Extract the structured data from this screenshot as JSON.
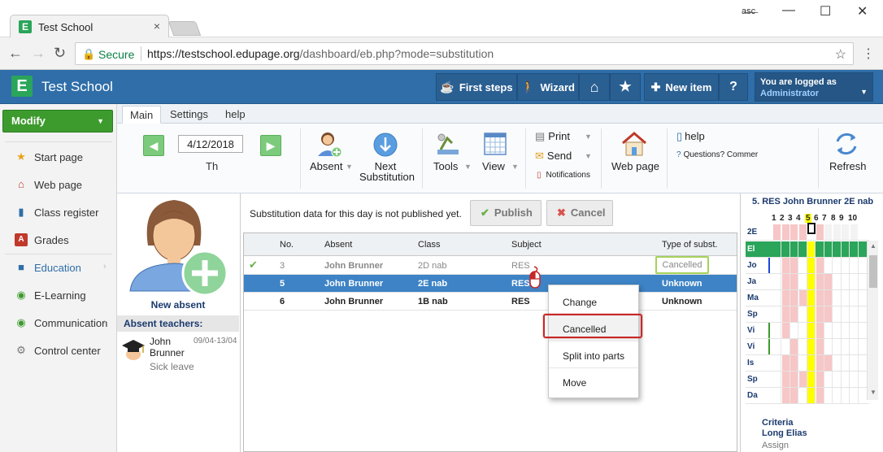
{
  "browser": {
    "tab_title": "Test School",
    "tab_close": "×",
    "favicon_letter": "E",
    "secure_label": "Secure",
    "url_host": "https://testschool.edupage.org",
    "url_path": "/dashboard/eb.php?mode=substitution",
    "user_icon": "a̶s̶c̶",
    "window_controls": [
      "—",
      "☐",
      "✕"
    ]
  },
  "header": {
    "logo_letter": "E",
    "app_name": "Test School",
    "buttons": [
      {
        "icon": "☕",
        "label": "First steps"
      },
      {
        "icon": "🚶",
        "label": "Wizard"
      },
      {
        "icon": "⌂",
        "label": ""
      },
      {
        "icon": "★",
        "label": ""
      },
      {
        "icon": "✚",
        "label": "New item"
      },
      {
        "icon": "?",
        "label": ""
      }
    ],
    "login_line1": "You are logged as",
    "login_line2": "Administrator"
  },
  "sidebar": {
    "modify_label": "Modify",
    "items": [
      {
        "label": "Start page",
        "icon": "★",
        "color": "#e8a317",
        "chevron": ""
      },
      {
        "label": "Web page",
        "icon": "⌂",
        "color": "#c0392b",
        "chevron": ""
      },
      {
        "label": "Class register",
        "icon": "▮",
        "color": "#2f6ea8",
        "chevron": ""
      },
      {
        "label": "Grades",
        "icon": "A",
        "color": "#c0392b",
        "chevron": ""
      },
      {
        "label": "Education",
        "icon": "■",
        "color": "#2f6ea8",
        "chevron": "›"
      },
      {
        "label": "E-Learning",
        "icon": "◉",
        "color": "#3d9b2e",
        "chevron": ""
      },
      {
        "label": "Communication",
        "icon": "◉",
        "color": "#3d9b2e",
        "chevron": "›"
      },
      {
        "label": "Control center",
        "icon": "⚙",
        "color": "#777777",
        "chevron": ""
      }
    ]
  },
  "ribbon": {
    "tabs": [
      "Main",
      "Settings",
      "help"
    ],
    "date": "4/12/2018",
    "day": "Th",
    "absent_label": "Absent",
    "next_line1": "Next",
    "next_line2": "Substitution",
    "tools_label": "Tools",
    "view_label": "View",
    "print_label": "Print",
    "send_label": "Send",
    "notifications_label": "Notifications",
    "webpage_label": "Web page",
    "help_label": "help",
    "questions_label": "Questions? Commer",
    "refresh_label": "Refresh"
  },
  "left_panel": {
    "new_absent_label": "New absent",
    "absent_teachers_header": "Absent teachers:",
    "teacher_first": "John",
    "teacher_last": "Brunner",
    "teacher_dates": "09/04-13/04",
    "teacher_reason": "Sick leave"
  },
  "main": {
    "notice": "Substitution data for this day is not published yet.",
    "publish_label": "Publish",
    "cancel_label": "Cancel",
    "columns": [
      "No.",
      "Absent",
      "Class",
      "Subject",
      "Type of subst."
    ],
    "rows": [
      {
        "no": "3",
        "absent": "John Brunner",
        "class": "2D nab",
        "subject": "RES",
        "type": "Cancelled"
      },
      {
        "no": "5",
        "absent": "John Brunner",
        "class": "2E nab",
        "subject": "RES",
        "type": "Unknown"
      },
      {
        "no": "6",
        "absent": "John Brunner",
        "class": "1B nab",
        "subject": "RES",
        "type": "Unknown"
      }
    ]
  },
  "context_menu": {
    "items": [
      "Change",
      "Cancelled",
      "Split into parts",
      "Move"
    ]
  },
  "right_panel": {
    "title": "5. RES John Brunner 2E nab",
    "period_numbers": [
      "1",
      "2",
      "3",
      "4",
      "5",
      "6",
      "7",
      "8",
      "9",
      "10"
    ],
    "class_label": "2E",
    "rows": [
      "El",
      "Jo",
      "Ja",
      "Ma",
      "Sp",
      "Vi",
      "Vi",
      "Is",
      "Sp",
      "Da"
    ],
    "criteria_line1": "Criteria",
    "criteria_line2": "Long Elias",
    "assign_label": "Assign"
  },
  "colors": {
    "header_blue": "#2f6ea8",
    "selected_row": "#3d83c5",
    "green_accent": "#3d9b2e",
    "cancelled_outline": "#a6d25a",
    "highlight_red": "#c62828",
    "tt_pink": "#f7c6c6",
    "tt_yellow": "#ffff00",
    "tt_green": "#2aa55a"
  }
}
